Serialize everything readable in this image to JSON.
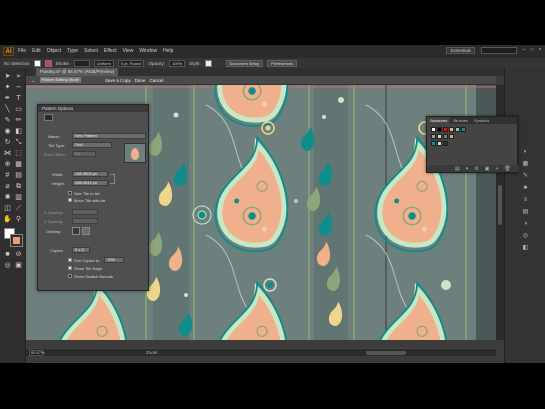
{
  "menubar": {
    "app_logo": "Ai",
    "items": [
      "File",
      "Edit",
      "Object",
      "Type",
      "Select",
      "Effect",
      "View",
      "Window",
      "Help"
    ],
    "workspace": "Essentials"
  },
  "control_bar": {
    "selection": "No Selection",
    "stroke_label": "Stroke:",
    "stroke_profile": "Uniform",
    "brush": "5 pt. Round",
    "opacity_label": "Opacity:",
    "opacity_value": "100%",
    "style_label": "Style:",
    "doc_setup": "Document Setup",
    "preferences": "Preferences"
  },
  "document_tab": "Paisley.ai* @ 66.67% (RGB/Preview)",
  "isolation_bar": {
    "field1": "Pattern Editing Mode",
    "save_copy": "Save a Copy",
    "done": "Done",
    "cancel": "Cancel"
  },
  "status_bar": {
    "zoom": "66.67%",
    "page": "Zoom"
  },
  "pattern_options": {
    "title": "Pattern Options",
    "name_label": "Name:",
    "name_value": "New Pattern",
    "tile_type_label": "Tile Type:",
    "tile_type_value": "Grid",
    "brick_offset_label": "Brick Offset:",
    "brick_offset_value": "1/2",
    "width_label": "Width:",
    "width_value": "188.3903 px",
    "height_label": "Height:",
    "height_value": "288.5942 px",
    "size_tile_label": "Size Tile to Art",
    "move_tile_label": "Move Tile with Art",
    "h_spacing_label": "H Spacing:",
    "v_spacing_label": "V Spacing:",
    "overlap_label": "Overlap:",
    "copies_label": "Copies:",
    "copies_value": "3 x 3",
    "dim_copies_label": "Dim Copies to:",
    "dim_copies_value": "70%",
    "show_tile_edge_label": "Show Tile Edge",
    "show_swatch_bounds_label": "Show Swatch Bounds"
  },
  "swatches_panel": {
    "tabs": [
      "Swatches",
      "Brushes",
      "Symbols"
    ],
    "colors": [
      "#ffffff",
      "#000000",
      "#ff0000",
      "#f4b183",
      "#7fc8c0",
      "#1b8c8c",
      "#8aa889",
      "#f2d58a",
      "#6a7f7c",
      "#e9a07a",
      "#009999",
      "#c9e4c5",
      "#333333"
    ]
  },
  "colors": {
    "canvas_bg": "#6d807d",
    "teal": "#0f8c8c",
    "peach": "#f0b08c",
    "mint": "#c6e8c4",
    "olive": "#8da57a",
    "yellow": "#eed68c",
    "cream": "#f4f1d8"
  }
}
